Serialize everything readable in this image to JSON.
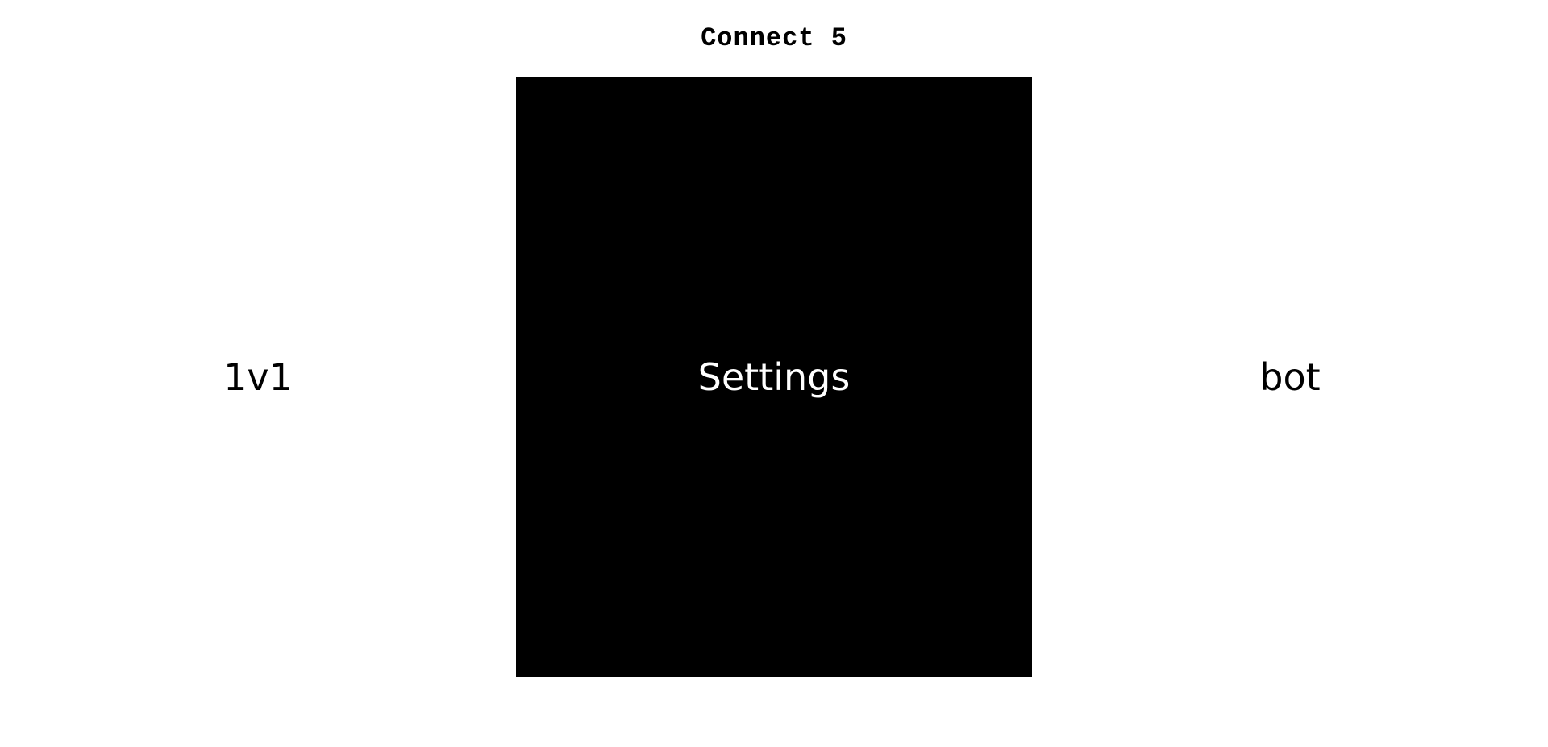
{
  "title": "Connect 5",
  "menu": {
    "options": [
      {
        "label": "1v1",
        "highlighted": false
      },
      {
        "label": "Settings",
        "highlighted": true
      },
      {
        "label": "bot",
        "highlighted": false
      }
    ]
  },
  "colors": {
    "background": "#ffffff",
    "highlight_background": "#000000",
    "highlight_text": "#ffffff",
    "text": "#000000"
  }
}
